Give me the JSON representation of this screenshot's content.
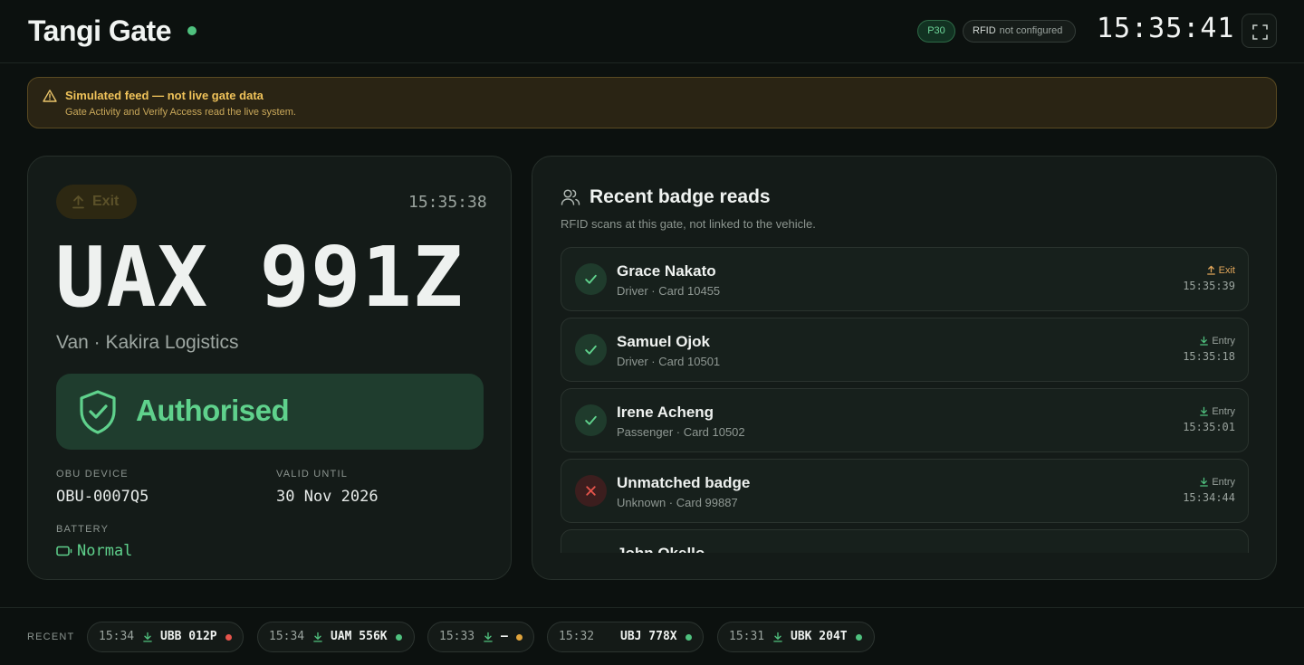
{
  "header": {
    "title": "Tangi Gate",
    "gate_code": "P30",
    "rfid_label": "RFID",
    "rfid_status": "not configured",
    "clock": "15:35:41"
  },
  "banner": {
    "title": "Simulated feed — not live gate data",
    "subtitle": "Gate Activity and Verify Access read the live system."
  },
  "current": {
    "direction": "Exit",
    "time": "15:35:38",
    "plate": "UAX 991Z",
    "vehicle": "Van · Kakira Logistics",
    "status": "Authorised",
    "obu_label": "OBU DEVICE",
    "obu_value": "OBU-0007Q5",
    "valid_label": "VALID UNTIL",
    "valid_value": "30 Nov 2026",
    "battery_label": "BATTERY",
    "battery_value": "Normal"
  },
  "reads": {
    "title": "Recent badge reads",
    "subtitle": "RFID scans at this gate, not linked to the vehicle.",
    "items": [
      {
        "name": "Grace Nakato",
        "meta": "Driver · Card 10455",
        "direction": "Exit",
        "time": "15:35:39",
        "ok": true
      },
      {
        "name": "Samuel Ojok",
        "meta": "Driver · Card 10501",
        "direction": "Entry",
        "time": "15:35:18",
        "ok": true
      },
      {
        "name": "Irene Acheng",
        "meta": "Passenger · Card 10502",
        "direction": "Entry",
        "time": "15:35:01",
        "ok": true
      },
      {
        "name": "Unmatched badge",
        "meta": "Unknown · Card 99887",
        "direction": "Entry",
        "time": "15:34:44",
        "ok": false
      },
      {
        "name": "John Okello",
        "meta": "",
        "direction": "",
        "time": "",
        "ok": true
      }
    ]
  },
  "recent": {
    "label": "RECENT",
    "items": [
      {
        "time": "15:34",
        "plate": "UBB 012P",
        "status_color": "#e5544b",
        "arrow": true
      },
      {
        "time": "15:34",
        "plate": "UAM 556K",
        "status_color": "#4fc17e",
        "arrow": true
      },
      {
        "time": "15:33",
        "plate": "—",
        "status_color": "#e0a43c",
        "arrow": true
      },
      {
        "time": "15:32",
        "plate": "UBJ 778X",
        "status_color": "#4fc17e",
        "arrow": false
      },
      {
        "time": "15:31",
        "plate": "UBK 204T",
        "status_color": "#4fc17e",
        "arrow": true
      }
    ]
  },
  "colors": {
    "accent_green": "#4fc17e",
    "warning_amber": "#f0c35a",
    "danger_red": "#e5544b"
  },
  "icons": [
    "warning-icon",
    "fullscreen-icon",
    "arrow-up-icon",
    "shield-check-icon",
    "battery-icon",
    "users-icon",
    "check-icon",
    "x-icon",
    "arrow-down-icon"
  ]
}
